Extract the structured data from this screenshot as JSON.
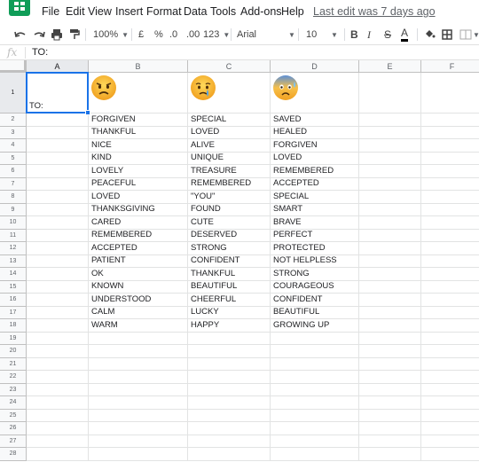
{
  "menu": {
    "items": [
      "File",
      "Edit",
      "View",
      "Insert",
      "Format",
      "Data",
      "Tools",
      "Add-ons",
      "Help"
    ],
    "last_edit": "Last edit was 7 days ago"
  },
  "toolbar": {
    "zoom": "100%",
    "currency": "£",
    "percent": "%",
    "decrease_decimals": ".0",
    "increase_decimals": ".00",
    "more_formats": "123",
    "font": "Arial",
    "font_size": "10",
    "bold": "B",
    "italic": "I",
    "strike": "S",
    "text_color": "A"
  },
  "formula_bar": {
    "fx": "fx",
    "value": "TO:"
  },
  "columns": [
    "A",
    "B",
    "C",
    "D",
    "E",
    "F"
  ],
  "rows": [
    "1",
    "2",
    "3",
    "4",
    "5",
    "6",
    "7",
    "8",
    "9",
    "10",
    "11",
    "12",
    "13",
    "14",
    "15",
    "16",
    "17",
    "18",
    "19",
    "20",
    "21",
    "22",
    "23",
    "24",
    "25",
    "26",
    "27",
    "28"
  ],
  "cells": {
    "a1": "TO:",
    "col_b": [
      "FORGIVEN",
      "THANKFUL",
      "NICE",
      "KIND",
      "LOVELY",
      "PEACEFUL",
      "LOVED",
      "THANKSGIVING",
      "CARED",
      "REMEMBERED",
      "ACCEPTED",
      "PATIENT",
      "OK",
      "KNOWN",
      "UNDERSTOOD",
      "CALM",
      "WARM"
    ],
    "col_c": [
      "SPECIAL",
      "LOVED",
      "ALIVE",
      "UNIQUE",
      "TREASURE",
      "REMEMBERED",
      "\"YOU\"",
      "FOUND",
      "CUTE",
      "DESERVED",
      "STRONG",
      "CONFIDENT",
      "THANKFUL",
      "BEAUTIFUL",
      "CHEERFUL",
      "LUCKY",
      "HAPPY"
    ],
    "col_d": [
      "SAVED",
      "HEALED",
      "FORGIVEN",
      "LOVED",
      "REMEMBERED",
      "ACCEPTED",
      "SPECIAL",
      "SMART",
      "BRAVE",
      "PERFECT",
      "PROTECTED",
      "NOT HELPLESS",
      "STRONG",
      "COURAGEOUS",
      "CONFIDENT",
      "BEAUTIFUL",
      "GROWING UP"
    ]
  },
  "emojis": [
    "angry-face-emoji",
    "crying-face-emoji",
    "anxious-face-emoji"
  ],
  "colors": {
    "accent": "#1a73e8",
    "brand": "#0f9d58",
    "emoji_yellow": "#f7c04a",
    "emoji_blue": "#5b8fd6"
  }
}
